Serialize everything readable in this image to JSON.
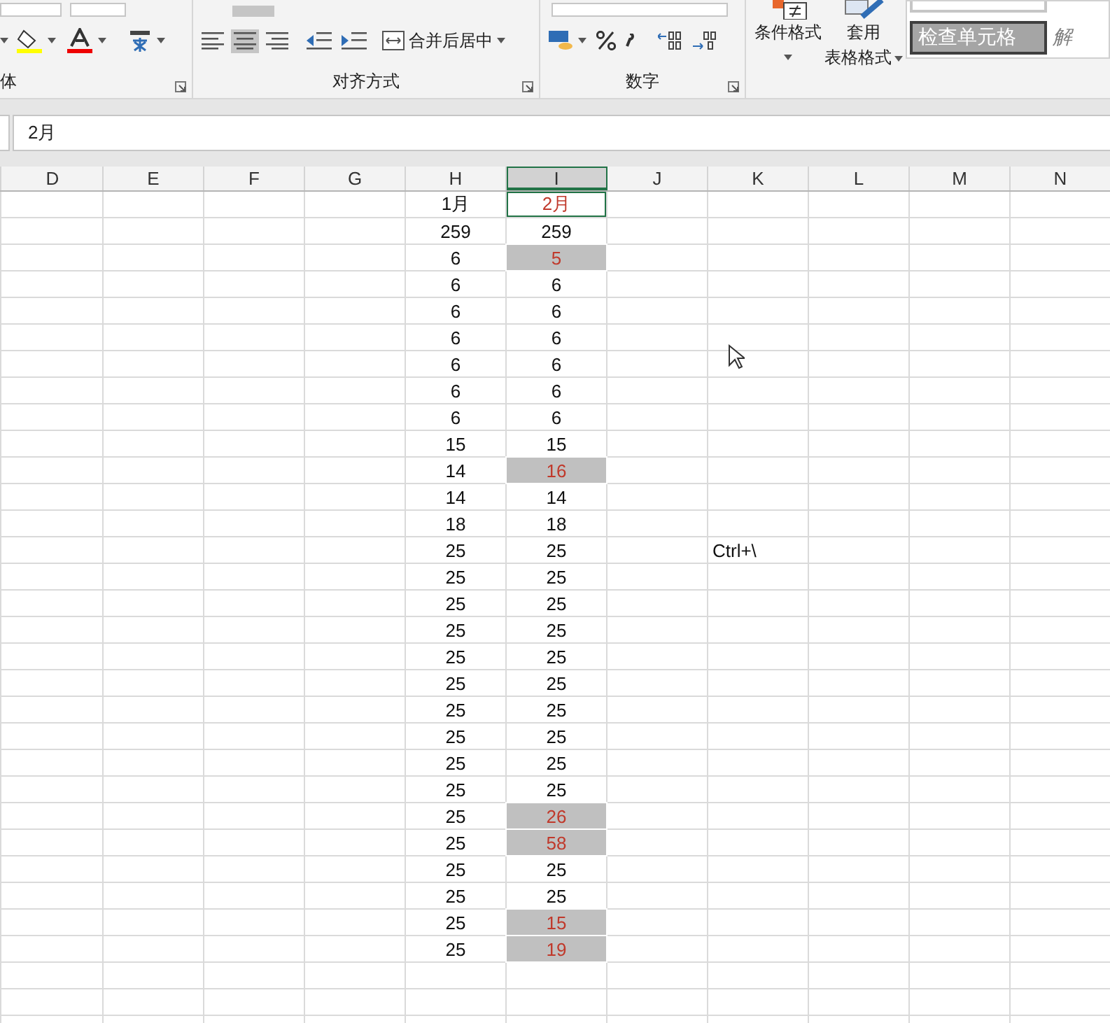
{
  "ribbon": {
    "groups": [
      {
        "label": "体"
      },
      {
        "label": "对齐方式"
      },
      {
        "label": "数字"
      }
    ],
    "merge_button": "合并后居中",
    "conditional_format": "条件格式",
    "table_format": [
      "套用",
      "表格格式"
    ],
    "styles": [
      {
        "label": "检查单元格",
        "kind": "check"
      },
      {
        "label": "解",
        "kind": "explain"
      }
    ],
    "center_align_selected": true
  },
  "formula_bar": {
    "value": "2月"
  },
  "columns": [
    {
      "label": "D",
      "selected": false
    },
    {
      "label": "E",
      "selected": false
    },
    {
      "label": "F",
      "selected": false
    },
    {
      "label": "G",
      "selected": false
    },
    {
      "label": "H",
      "selected": false
    },
    {
      "label": "I",
      "selected": true
    },
    {
      "label": "J",
      "selected": false
    },
    {
      "label": "K",
      "selected": false
    },
    {
      "label": "L",
      "selected": false
    },
    {
      "label": "M",
      "selected": false
    },
    {
      "label": "N",
      "selected": false
    }
  ],
  "rows": [
    {
      "h": "1月",
      "i": "2月",
      "differs": true,
      "highlighted": false,
      "selected": true
    },
    {
      "h": "259",
      "i": "259",
      "differs": false,
      "highlighted": false,
      "selected": false
    },
    {
      "h": "6",
      "i": "5",
      "differs": true,
      "highlighted": true,
      "selected": false
    },
    {
      "h": "6",
      "i": "6",
      "differs": false,
      "highlighted": false,
      "selected": false
    },
    {
      "h": "6",
      "i": "6",
      "differs": false,
      "highlighted": false,
      "selected": false
    },
    {
      "h": "6",
      "i": "6",
      "differs": false,
      "highlighted": false,
      "selected": false
    },
    {
      "h": "6",
      "i": "6",
      "differs": false,
      "highlighted": false,
      "selected": false
    },
    {
      "h": "6",
      "i": "6",
      "differs": false,
      "highlighted": false,
      "selected": false
    },
    {
      "h": "6",
      "i": "6",
      "differs": false,
      "highlighted": false,
      "selected": false
    },
    {
      "h": "15",
      "i": "15",
      "differs": false,
      "highlighted": false,
      "selected": false
    },
    {
      "h": "14",
      "i": "16",
      "differs": true,
      "highlighted": true,
      "selected": false
    },
    {
      "h": "14",
      "i": "14",
      "differs": false,
      "highlighted": false,
      "selected": false
    },
    {
      "h": "18",
      "i": "18",
      "differs": false,
      "highlighted": false,
      "selected": false
    },
    {
      "h": "25",
      "i": "25",
      "differs": false,
      "highlighted": false,
      "selected": false,
      "k": "Ctrl+\\"
    },
    {
      "h": "25",
      "i": "25",
      "differs": false,
      "highlighted": false,
      "selected": false
    },
    {
      "h": "25",
      "i": "25",
      "differs": false,
      "highlighted": false,
      "selected": false
    },
    {
      "h": "25",
      "i": "25",
      "differs": false,
      "highlighted": false,
      "selected": false
    },
    {
      "h": "25",
      "i": "25",
      "differs": false,
      "highlighted": false,
      "selected": false
    },
    {
      "h": "25",
      "i": "25",
      "differs": false,
      "highlighted": false,
      "selected": false
    },
    {
      "h": "25",
      "i": "25",
      "differs": false,
      "highlighted": false,
      "selected": false
    },
    {
      "h": "25",
      "i": "25",
      "differs": false,
      "highlighted": false,
      "selected": false
    },
    {
      "h": "25",
      "i": "25",
      "differs": false,
      "highlighted": false,
      "selected": false
    },
    {
      "h": "25",
      "i": "25",
      "differs": false,
      "highlighted": false,
      "selected": false
    },
    {
      "h": "25",
      "i": "26",
      "differs": true,
      "highlighted": true,
      "selected": false
    },
    {
      "h": "25",
      "i": "58",
      "differs": true,
      "highlighted": true,
      "selected": false
    },
    {
      "h": "25",
      "i": "25",
      "differs": false,
      "highlighted": false,
      "selected": false
    },
    {
      "h": "25",
      "i": "25",
      "differs": false,
      "highlighted": false,
      "selected": false
    },
    {
      "h": "25",
      "i": "15",
      "differs": true,
      "highlighted": true,
      "selected": false
    },
    {
      "h": "25",
      "i": "19",
      "differs": true,
      "highlighted": true,
      "selected": false
    }
  ]
}
